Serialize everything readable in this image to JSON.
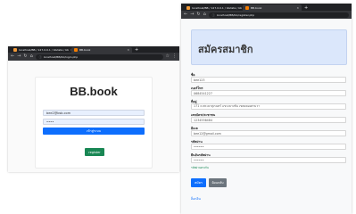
{
  "login_window": {
    "tabs": [
      {
        "title": "localhost/BB / 127.0.0.1 / bbdata / bb"
      },
      {
        "title": "BB.book"
      }
    ],
    "url": "localhost/BB/bb/login.php",
    "page": {
      "title": "BB.book",
      "email_value": "bee2@bsb.com",
      "password_value": "••••",
      "login_button": "เข้าสู่ระบบ",
      "register_button": "register"
    }
  },
  "register_window": {
    "tabs": [
      {
        "title": "localhost/BB / 127.0.0.1 / bbdata / bb"
      },
      {
        "title": "BB.book"
      }
    ],
    "url": "localhost/BB/bb/register.php",
    "page": {
      "title": "สมัครสมาชิก",
      "fields": [
        {
          "label": "ชื่อ",
          "value": "bee123"
        },
        {
          "label": "เบอร์โทร",
          "value": "0684541227"
        },
        {
          "label": "ที่อยู่",
          "value": "171 ถ.พระยาสุเรนทร์ แขวงบางชัน เขตคลองสามวา"
        },
        {
          "label": "เลขบัตรประชาชน",
          "value": "1234556484"
        },
        {
          "label": "อีเมล",
          "value": "bee12@gmail.com"
        },
        {
          "label": "รหัสผ่าน",
          "value": "••••••"
        },
        {
          "label": "ยืนยันรหัสผ่าน",
          "value": "••••••"
        }
      ],
      "hint": "รหัสผ่านตรงกัน",
      "submit_button": "สมัคร",
      "back_button": "ย้อนกลับ",
      "login_link": "ล็อกอิน"
    }
  },
  "colors": {
    "chrome_dark": "#202124",
    "chrome_toolbar": "#35363a",
    "primary": "#0d6efd",
    "success": "#198754",
    "secondary": "#6c757d",
    "header_bg": "#dbe7fb"
  }
}
